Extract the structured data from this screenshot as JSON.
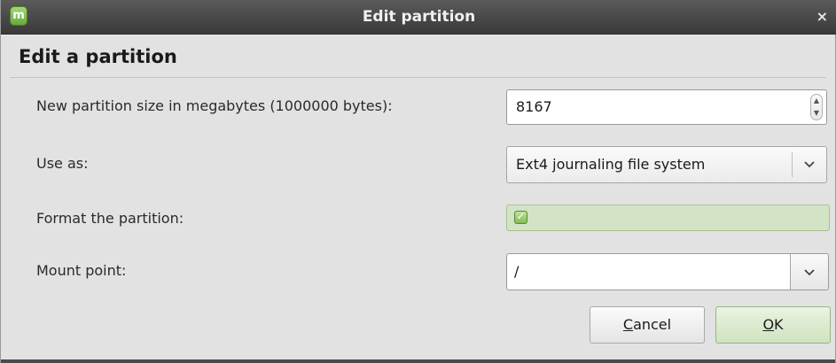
{
  "window": {
    "title": "Edit partition",
    "close_glyph": "×"
  },
  "heading": "Edit a partition",
  "fields": {
    "size": {
      "label": "New partition size in megabytes (1000000 bytes):",
      "value": "8167"
    },
    "use_as": {
      "label": "Use as:",
      "value": "Ext4 journaling file system"
    },
    "format": {
      "label": "Format the partition:",
      "checked": true,
      "check_glyph": "✓"
    },
    "mount": {
      "label": "Mount point:",
      "value": "/"
    }
  },
  "buttons": {
    "cancel": {
      "mnemonic": "C",
      "rest": "ancel"
    },
    "ok": {
      "mnemonic": "O",
      "rest": "K"
    }
  },
  "colors": {
    "accent_green": "#86bb57",
    "titlebar": "#3a3a3a"
  }
}
